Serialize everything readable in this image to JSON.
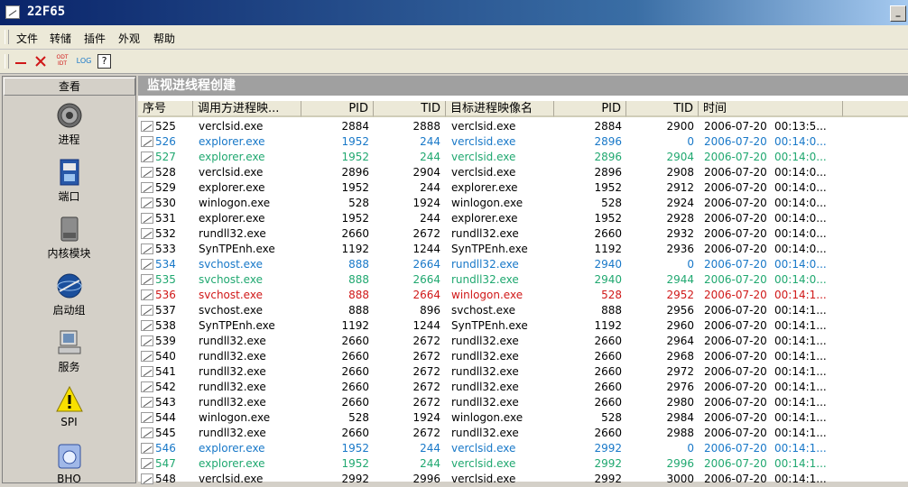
{
  "window": {
    "title": "22F65",
    "minimize": "_"
  },
  "menu": [
    "文件",
    "转储",
    "插件",
    "外观",
    "帮助"
  ],
  "toolbar": {
    "minus_icon": "minus-icon",
    "close_icon": "x-icon",
    "odt": "ODT\nIDT",
    "log": "LOG",
    "help": "?"
  },
  "sidebar": {
    "header": "查看",
    "items": [
      {
        "label": "进程",
        "icon": "gear-icon"
      },
      {
        "label": "端口",
        "icon": "network-port-icon"
      },
      {
        "label": "内核模块",
        "icon": "disk-icon"
      },
      {
        "label": "启动组",
        "icon": "globe-icon"
      },
      {
        "label": "服务",
        "icon": "computer-icon"
      },
      {
        "label": "SPI",
        "icon": "warning-icon"
      },
      {
        "label": "BHO",
        "icon": "browser-icon"
      }
    ]
  },
  "panel": {
    "title": "监视进线程创建"
  },
  "table": {
    "columns": [
      "序号",
      "调用方进程映...",
      "PID",
      "TID",
      "目标进程映像名",
      "PID",
      "TID",
      "时间"
    ],
    "rows": [
      [
        "525",
        "verclsid.exe",
        "2884",
        "2888",
        "verclsid.exe",
        "2884",
        "2900",
        "2006-07-20",
        "00:13:5..."
      ],
      [
        "526",
        "explorer.exe",
        "1952",
        "244",
        "verclsid.exe",
        "2896",
        "0",
        "2006-07-20",
        "00:14:0..."
      ],
      [
        "527",
        "explorer.exe",
        "1952",
        "244",
        "verclsid.exe",
        "2896",
        "2904",
        "2006-07-20",
        "00:14:0..."
      ],
      [
        "528",
        "verclsid.exe",
        "2896",
        "2904",
        "verclsid.exe",
        "2896",
        "2908",
        "2006-07-20",
        "00:14:0..."
      ],
      [
        "529",
        "explorer.exe",
        "1952",
        "244",
        "explorer.exe",
        "1952",
        "2912",
        "2006-07-20",
        "00:14:0..."
      ],
      [
        "530",
        "winlogon.exe",
        "528",
        "1924",
        "winlogon.exe",
        "528",
        "2924",
        "2006-07-20",
        "00:14:0..."
      ],
      [
        "531",
        "explorer.exe",
        "1952",
        "244",
        "explorer.exe",
        "1952",
        "2928",
        "2006-07-20",
        "00:14:0..."
      ],
      [
        "532",
        "rundll32.exe",
        "2660",
        "2672",
        "rundll32.exe",
        "2660",
        "2932",
        "2006-07-20",
        "00:14:0..."
      ],
      [
        "533",
        "SynTPEnh.exe",
        "1192",
        "1244",
        "SynTPEnh.exe",
        "1192",
        "2936",
        "2006-07-20",
        "00:14:0..."
      ],
      [
        "534",
        "svchost.exe",
        "888",
        "2664",
        "rundll32.exe",
        "2940",
        "0",
        "2006-07-20",
        "00:14:0..."
      ],
      [
        "535",
        "svchost.exe",
        "888",
        "2664",
        "rundll32.exe",
        "2940",
        "2944",
        "2006-07-20",
        "00:14:0..."
      ],
      [
        "536",
        "svchost.exe",
        "888",
        "2664",
        "winlogon.exe",
        "528",
        "2952",
        "2006-07-20",
        "00:14:1..."
      ],
      [
        "537",
        "svchost.exe",
        "888",
        "896",
        "svchost.exe",
        "888",
        "2956",
        "2006-07-20",
        "00:14:1..."
      ],
      [
        "538",
        "SynTPEnh.exe",
        "1192",
        "1244",
        "SynTPEnh.exe",
        "1192",
        "2960",
        "2006-07-20",
        "00:14:1..."
      ],
      [
        "539",
        "rundll32.exe",
        "2660",
        "2672",
        "rundll32.exe",
        "2660",
        "2964",
        "2006-07-20",
        "00:14:1..."
      ],
      [
        "540",
        "rundll32.exe",
        "2660",
        "2672",
        "rundll32.exe",
        "2660",
        "2968",
        "2006-07-20",
        "00:14:1..."
      ],
      [
        "541",
        "rundll32.exe",
        "2660",
        "2672",
        "rundll32.exe",
        "2660",
        "2972",
        "2006-07-20",
        "00:14:1..."
      ],
      [
        "542",
        "rundll32.exe",
        "2660",
        "2672",
        "rundll32.exe",
        "2660",
        "2976",
        "2006-07-20",
        "00:14:1..."
      ],
      [
        "543",
        "rundll32.exe",
        "2660",
        "2672",
        "rundll32.exe",
        "2660",
        "2980",
        "2006-07-20",
        "00:14:1..."
      ],
      [
        "544",
        "winlogon.exe",
        "528",
        "1924",
        "winlogon.exe",
        "528",
        "2984",
        "2006-07-20",
        "00:14:1..."
      ],
      [
        "545",
        "rundll32.exe",
        "2660",
        "2672",
        "rundll32.exe",
        "2660",
        "2988",
        "2006-07-20",
        "00:14:1..."
      ],
      [
        "546",
        "explorer.exe",
        "1952",
        "244",
        "verclsid.exe",
        "2992",
        "0",
        "2006-07-20",
        "00:14:1..."
      ],
      [
        "547",
        "explorer.exe",
        "1952",
        "244",
        "verclsid.exe",
        "2992",
        "2996",
        "2006-07-20",
        "00:14:1..."
      ],
      [
        "548",
        "verclsid.exe",
        "2992",
        "2996",
        "verclsid.exe",
        "2992",
        "3000",
        "2006-07-20",
        "00:14:1..."
      ]
    ],
    "row_colors": [
      "",
      "blue",
      "green",
      "",
      "",
      "",
      "",
      "",
      "",
      "blue",
      "green",
      "red",
      "",
      "",
      "",
      "",
      "",
      "",
      "",
      "",
      "",
      "blue",
      "green",
      ""
    ]
  },
  "colors": {
    "blue": "#1878c8",
    "green": "#20a870",
    "red": "#d01818"
  }
}
